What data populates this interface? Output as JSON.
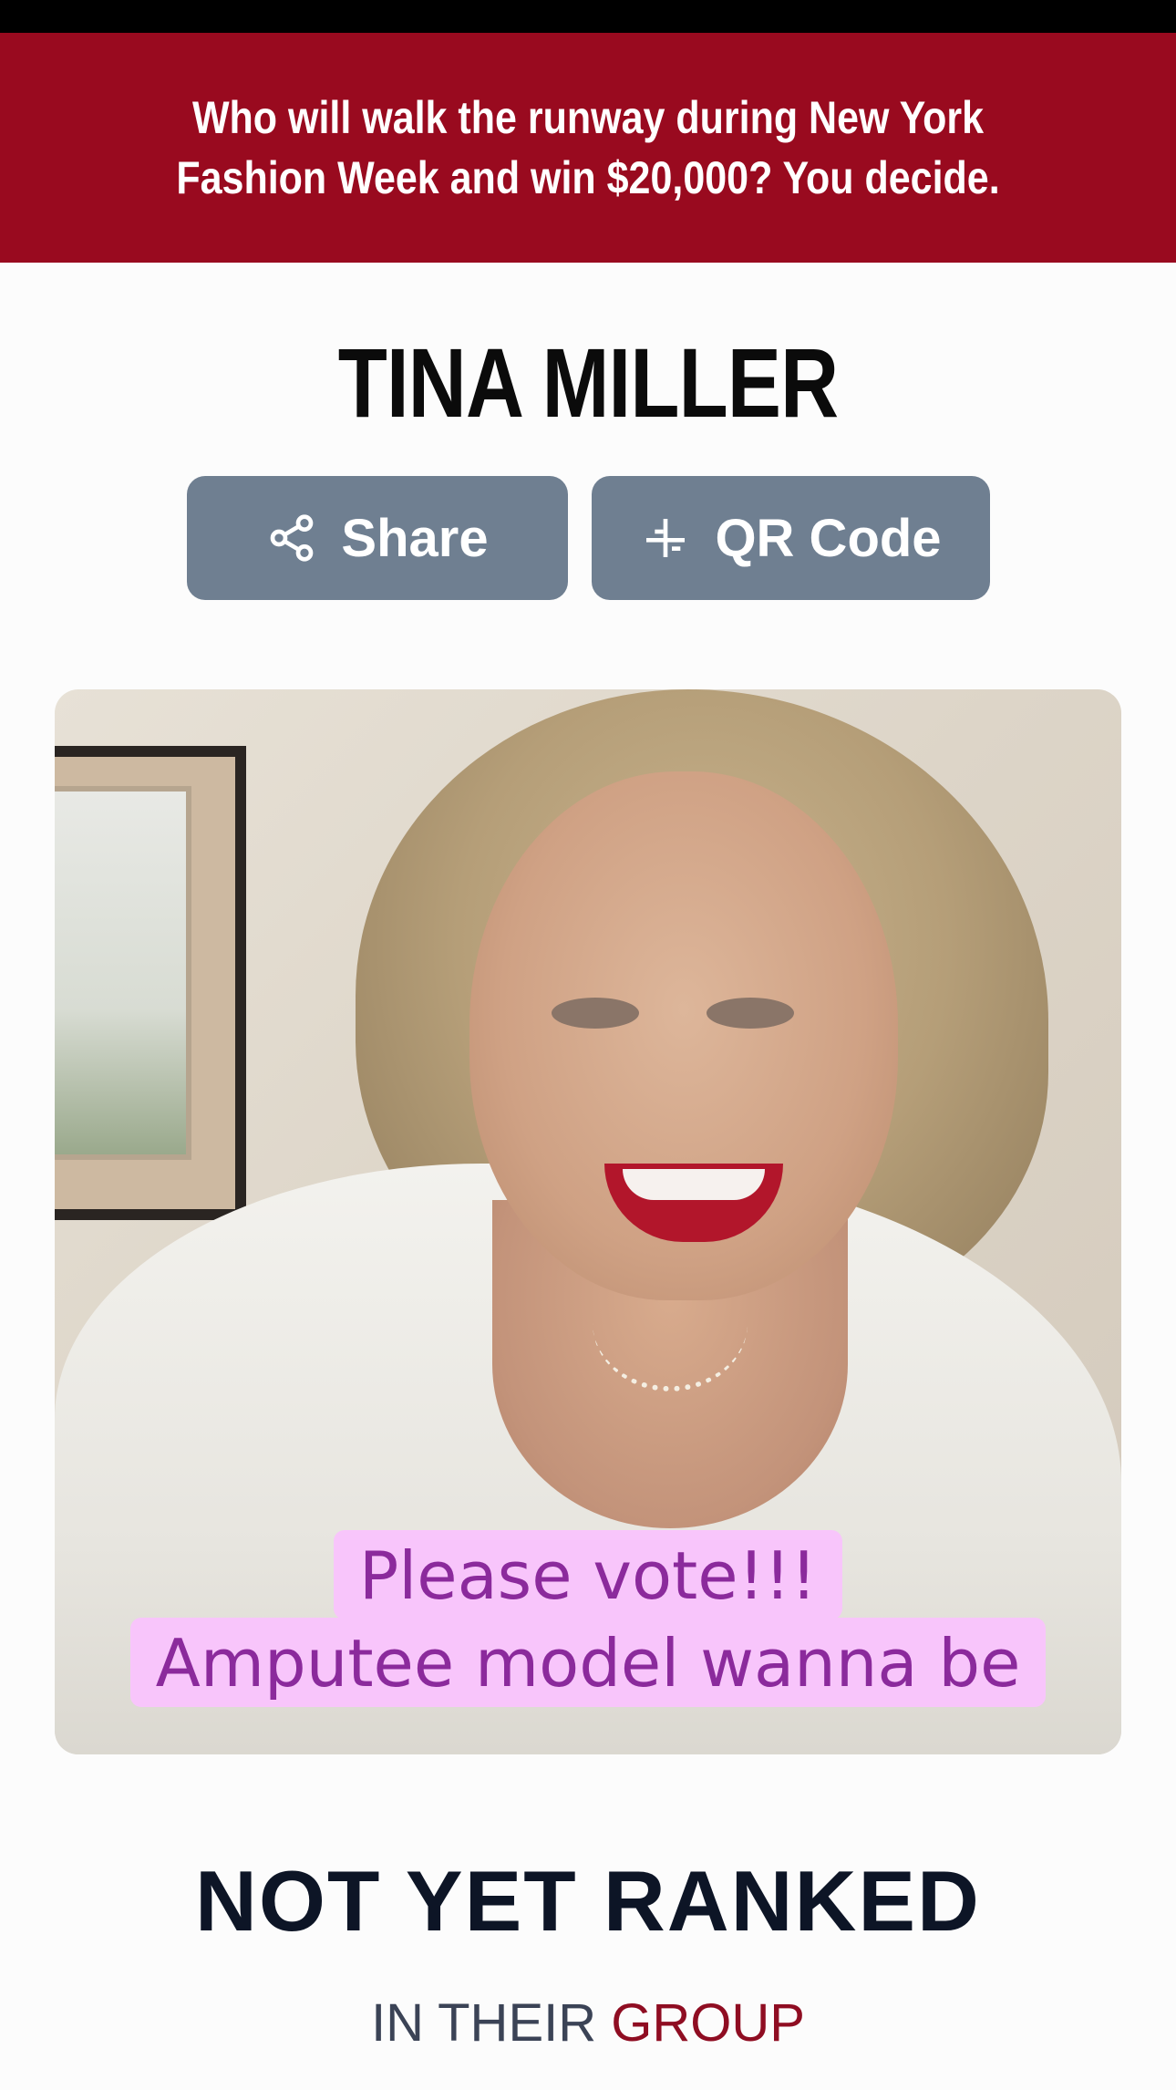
{
  "banner": {
    "text": "Who will walk the runway during New York Fashion Week and win $20,000?  You decide."
  },
  "contestant": {
    "name": "TINA MILLER"
  },
  "actions": {
    "share_label": "Share",
    "share_icon": "share-icon",
    "qr_label": "QR Code",
    "qr_icon": "qr-code-icon"
  },
  "photo": {
    "caption_line1": "Please vote!!!",
    "caption_line2": "Amputee model wanna be"
  },
  "ranking": {
    "status": "NOT YET RANKED",
    "sub_prefix": "IN THEIR ",
    "sub_accent": "GROUP"
  },
  "colors": {
    "banner_bg": "#990a1f",
    "button_bg": "#6f7f91",
    "caption_bg": "#f8c5fb",
    "caption_text": "#8b2a9c",
    "accent": "#8f0d22"
  }
}
